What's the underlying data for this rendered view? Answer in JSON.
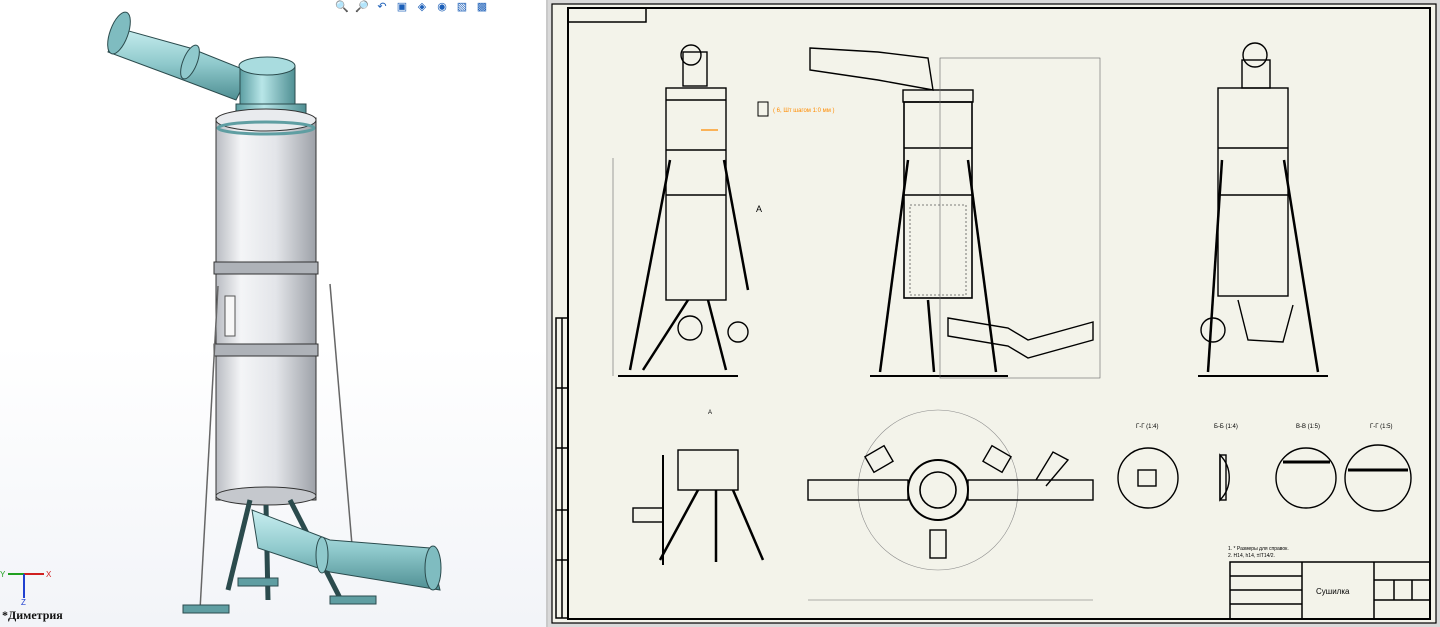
{
  "left_view": {
    "view_name": "*Диметрия",
    "toolbar_icons": [
      "zoom-to-fit-icon",
      "zoom-area-icon",
      "previous-view-icon",
      "section-view-icon",
      "display-style-icon",
      "hide-show-icon",
      "appearance-icon",
      "view-orientation-icon"
    ],
    "triad": {
      "x_label": "X",
      "y_label": "Y",
      "z_label": "Z"
    },
    "colors": {
      "pipe": "#8fc9cc",
      "body": "#e4e6ea",
      "band": "#aeb2b8"
    }
  },
  "drawing": {
    "title_block_name": "Сушилка",
    "notes": [
      "1. * Размеры для справок.",
      "2. Н14, h14, ±IT14/2."
    ],
    "view_labels": {
      "view_a": "А",
      "section_1": "Г-Г (1:4)",
      "section_2": "Б-Б (1:4)",
      "section_3": "В-В (1:5)",
      "section_4": "Г-Г (1:5)",
      "detail_a": "А"
    },
    "weld_note": "( 6, Шт шагом 1:0 мм )",
    "colors": {
      "sheet": "#f3f3ea",
      "line": "#000000",
      "dim": "#666666",
      "highlight": "#ff8c00"
    }
  }
}
